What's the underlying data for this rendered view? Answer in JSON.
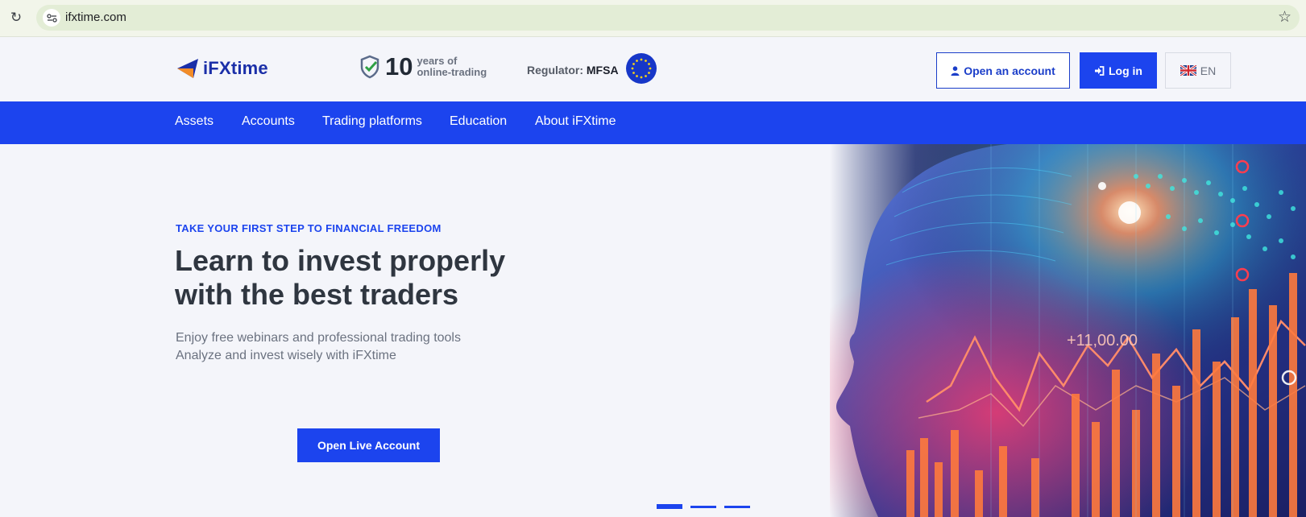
{
  "browser": {
    "url": "ifxtime.com",
    "reload_icon": "reload-icon",
    "site_settings_icon": "tune-icon",
    "bookmark_icon": "star-icon"
  },
  "header": {
    "logo_text": "iFXtime",
    "years_number": "10",
    "years_line1": "years of",
    "years_line2": "online-trading",
    "regulator_label": "Regulator:",
    "regulator_name": "MFSA",
    "open_account_label": "Open an account",
    "login_label": "Log in",
    "language_label": "EN"
  },
  "nav": {
    "items": [
      "Assets",
      "Accounts",
      "Trading platforms",
      "Education",
      "About iFXtime"
    ]
  },
  "hero": {
    "kicker": "TAKE YOUR FIRST STEP TO FINANCIAL FREEDOM",
    "headline_line1": "Learn to invest properly",
    "headline_line2": "with the best traders",
    "sub_line1": "Enjoy free webinars and professional trading tools",
    "sub_line2": "Analyze and invest wisely with iFXtime",
    "cta_label": "Open Live Account",
    "art_value_label": "+11,00.00",
    "slides_total": 3,
    "active_slide": 1
  },
  "colors": {
    "brand_blue": "#1c44ee",
    "logo_blue": "#1b2fa8",
    "logo_orange": "#f28c28",
    "text_dark": "#2f3640"
  }
}
